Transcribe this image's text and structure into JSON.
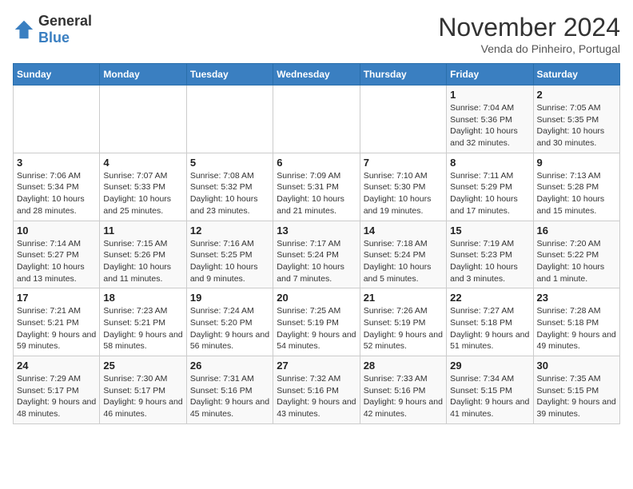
{
  "header": {
    "logo_general": "General",
    "logo_blue": "Blue",
    "month_title": "November 2024",
    "subtitle": "Venda do Pinheiro, Portugal"
  },
  "days_of_week": [
    "Sunday",
    "Monday",
    "Tuesday",
    "Wednesday",
    "Thursday",
    "Friday",
    "Saturday"
  ],
  "weeks": [
    [
      {
        "day": "",
        "info": ""
      },
      {
        "day": "",
        "info": ""
      },
      {
        "day": "",
        "info": ""
      },
      {
        "day": "",
        "info": ""
      },
      {
        "day": "",
        "info": ""
      },
      {
        "day": "1",
        "info": "Sunrise: 7:04 AM\nSunset: 5:36 PM\nDaylight: 10 hours and 32 minutes."
      },
      {
        "day": "2",
        "info": "Sunrise: 7:05 AM\nSunset: 5:35 PM\nDaylight: 10 hours and 30 minutes."
      }
    ],
    [
      {
        "day": "3",
        "info": "Sunrise: 7:06 AM\nSunset: 5:34 PM\nDaylight: 10 hours and 28 minutes."
      },
      {
        "day": "4",
        "info": "Sunrise: 7:07 AM\nSunset: 5:33 PM\nDaylight: 10 hours and 25 minutes."
      },
      {
        "day": "5",
        "info": "Sunrise: 7:08 AM\nSunset: 5:32 PM\nDaylight: 10 hours and 23 minutes."
      },
      {
        "day": "6",
        "info": "Sunrise: 7:09 AM\nSunset: 5:31 PM\nDaylight: 10 hours and 21 minutes."
      },
      {
        "day": "7",
        "info": "Sunrise: 7:10 AM\nSunset: 5:30 PM\nDaylight: 10 hours and 19 minutes."
      },
      {
        "day": "8",
        "info": "Sunrise: 7:11 AM\nSunset: 5:29 PM\nDaylight: 10 hours and 17 minutes."
      },
      {
        "day": "9",
        "info": "Sunrise: 7:13 AM\nSunset: 5:28 PM\nDaylight: 10 hours and 15 minutes."
      }
    ],
    [
      {
        "day": "10",
        "info": "Sunrise: 7:14 AM\nSunset: 5:27 PM\nDaylight: 10 hours and 13 minutes."
      },
      {
        "day": "11",
        "info": "Sunrise: 7:15 AM\nSunset: 5:26 PM\nDaylight: 10 hours and 11 minutes."
      },
      {
        "day": "12",
        "info": "Sunrise: 7:16 AM\nSunset: 5:25 PM\nDaylight: 10 hours and 9 minutes."
      },
      {
        "day": "13",
        "info": "Sunrise: 7:17 AM\nSunset: 5:24 PM\nDaylight: 10 hours and 7 minutes."
      },
      {
        "day": "14",
        "info": "Sunrise: 7:18 AM\nSunset: 5:24 PM\nDaylight: 10 hours and 5 minutes."
      },
      {
        "day": "15",
        "info": "Sunrise: 7:19 AM\nSunset: 5:23 PM\nDaylight: 10 hours and 3 minutes."
      },
      {
        "day": "16",
        "info": "Sunrise: 7:20 AM\nSunset: 5:22 PM\nDaylight: 10 hours and 1 minute."
      }
    ],
    [
      {
        "day": "17",
        "info": "Sunrise: 7:21 AM\nSunset: 5:21 PM\nDaylight: 9 hours and 59 minutes."
      },
      {
        "day": "18",
        "info": "Sunrise: 7:23 AM\nSunset: 5:21 PM\nDaylight: 9 hours and 58 minutes."
      },
      {
        "day": "19",
        "info": "Sunrise: 7:24 AM\nSunset: 5:20 PM\nDaylight: 9 hours and 56 minutes."
      },
      {
        "day": "20",
        "info": "Sunrise: 7:25 AM\nSunset: 5:19 PM\nDaylight: 9 hours and 54 minutes."
      },
      {
        "day": "21",
        "info": "Sunrise: 7:26 AM\nSunset: 5:19 PM\nDaylight: 9 hours and 52 minutes."
      },
      {
        "day": "22",
        "info": "Sunrise: 7:27 AM\nSunset: 5:18 PM\nDaylight: 9 hours and 51 minutes."
      },
      {
        "day": "23",
        "info": "Sunrise: 7:28 AM\nSunset: 5:18 PM\nDaylight: 9 hours and 49 minutes."
      }
    ],
    [
      {
        "day": "24",
        "info": "Sunrise: 7:29 AM\nSunset: 5:17 PM\nDaylight: 9 hours and 48 minutes."
      },
      {
        "day": "25",
        "info": "Sunrise: 7:30 AM\nSunset: 5:17 PM\nDaylight: 9 hours and 46 minutes."
      },
      {
        "day": "26",
        "info": "Sunrise: 7:31 AM\nSunset: 5:16 PM\nDaylight: 9 hours and 45 minutes."
      },
      {
        "day": "27",
        "info": "Sunrise: 7:32 AM\nSunset: 5:16 PM\nDaylight: 9 hours and 43 minutes."
      },
      {
        "day": "28",
        "info": "Sunrise: 7:33 AM\nSunset: 5:16 PM\nDaylight: 9 hours and 42 minutes."
      },
      {
        "day": "29",
        "info": "Sunrise: 7:34 AM\nSunset: 5:15 PM\nDaylight: 9 hours and 41 minutes."
      },
      {
        "day": "30",
        "info": "Sunrise: 7:35 AM\nSunset: 5:15 PM\nDaylight: 9 hours and 39 minutes."
      }
    ]
  ]
}
